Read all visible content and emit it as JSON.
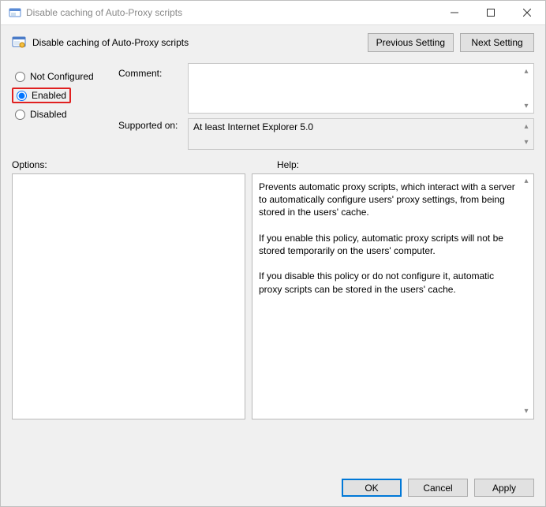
{
  "window": {
    "title": "Disable caching of Auto-Proxy scripts"
  },
  "header": {
    "title": "Disable caching of Auto-Proxy scripts",
    "previous_setting": "Previous Setting",
    "next_setting": "Next Setting"
  },
  "radios": {
    "not_configured": "Not Configured",
    "enabled": "Enabled",
    "disabled": "Disabled",
    "selected": "enabled"
  },
  "labels": {
    "comment": "Comment:",
    "supported_on": "Supported on:",
    "options": "Options:",
    "help": "Help:"
  },
  "fields": {
    "comment": "",
    "supported_on": "At least Internet Explorer 5.0"
  },
  "help_text": "Prevents automatic proxy scripts, which interact with a server to automatically configure users' proxy settings, from being stored in the users' cache.\n\nIf you enable this policy, automatic proxy scripts will not be stored temporarily on the users' computer.\n\nIf you disable this policy or do not configure it, automatic proxy scripts can be stored in the users' cache.",
  "footer": {
    "ok": "OK",
    "cancel": "Cancel",
    "apply": "Apply"
  }
}
